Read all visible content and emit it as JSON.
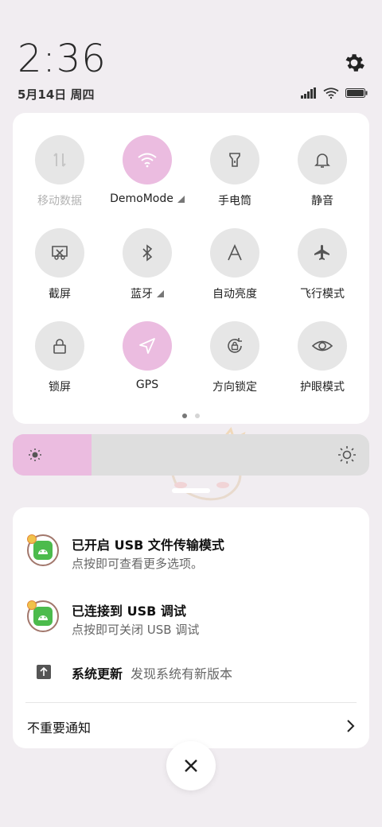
{
  "header": {
    "time": "2:36",
    "date": "5月14日 周四"
  },
  "quick_settings": {
    "tiles": [
      {
        "label": "移动数据",
        "active": false,
        "disabled": true,
        "icon": "mobile-data-icon"
      },
      {
        "label": "DemoMode",
        "active": true,
        "expandable": true,
        "icon": "wifi-icon"
      },
      {
        "label": "手电筒",
        "active": false,
        "icon": "flashlight-icon"
      },
      {
        "label": "静音",
        "active": false,
        "icon": "bell-icon"
      },
      {
        "label": "截屏",
        "active": false,
        "icon": "screenshot-icon"
      },
      {
        "label": "蓝牙",
        "active": false,
        "expandable": true,
        "icon": "bluetooth-icon"
      },
      {
        "label": "自动亮度",
        "active": false,
        "icon": "auto-brightness-icon"
      },
      {
        "label": "飞行模式",
        "active": false,
        "icon": "airplane-icon"
      },
      {
        "label": "锁屏",
        "active": false,
        "icon": "lock-icon"
      },
      {
        "label": "GPS",
        "active": true,
        "icon": "location-icon"
      },
      {
        "label": "方向锁定",
        "active": false,
        "icon": "rotation-lock-icon"
      },
      {
        "label": "护眼模式",
        "active": false,
        "icon": "eye-icon"
      }
    ],
    "page_count": 2,
    "current_page": 1
  },
  "brightness": {
    "level": 0.22
  },
  "notifications": [
    {
      "title": "已开启 USB 文件传输模式",
      "subtitle": "点按即可查看更多选项。"
    },
    {
      "title": "已连接到 USB 调试",
      "subtitle": "点按即可关闭 USB 调试"
    }
  ],
  "system_update": {
    "title": "系统更新",
    "text": "发现系统有新版本"
  },
  "unimportant_label": "不重要通知",
  "colors": {
    "accent": "#ebbce0",
    "background": "#f1edf1",
    "tile_inactive": "#e6e6e6"
  }
}
